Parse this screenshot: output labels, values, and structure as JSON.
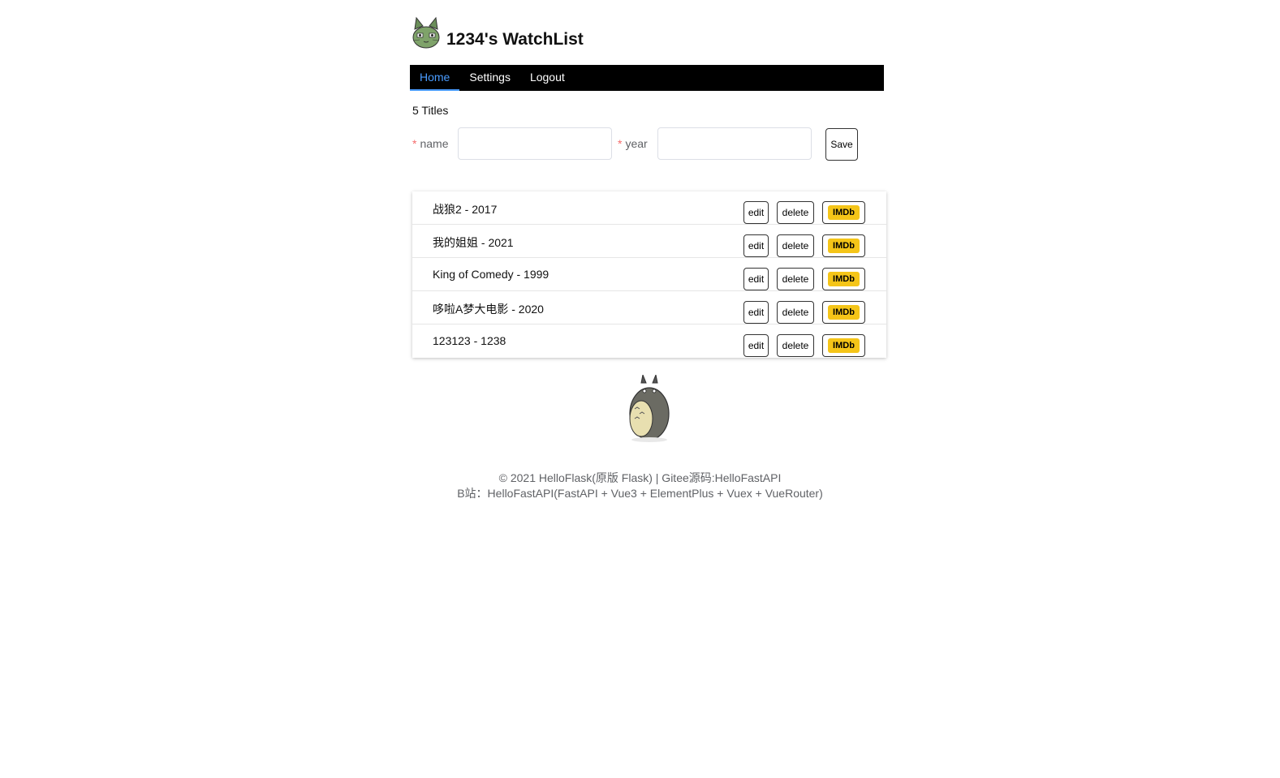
{
  "header": {
    "title": "1234's WatchList",
    "avatar_icon": "cat-avatar-icon"
  },
  "nav": {
    "items": [
      {
        "label": "Home",
        "active": true
      },
      {
        "label": "Settings",
        "active": false
      },
      {
        "label": "Logout",
        "active": false
      }
    ]
  },
  "summary": {
    "count_text": "5 Titles"
  },
  "form": {
    "name_label": "name",
    "name_required": "*",
    "name_value": "",
    "year_label": "year",
    "year_required": "*",
    "year_value": "",
    "save_label": "Save"
  },
  "movies": [
    {
      "title": "战狼2 - 2017",
      "edit": "edit",
      "delete": "delete",
      "imdb": "IMDb"
    },
    {
      "title": "我的姐姐 - 2021",
      "edit": "edit",
      "delete": "delete",
      "imdb": "IMDb"
    },
    {
      "title": "King of Comedy - 1999",
      "edit": "edit",
      "delete": "delete",
      "imdb": "IMDb"
    },
    {
      "title": "哆啦A梦大电影 - 2020",
      "edit": "edit",
      "delete": "delete",
      "imdb": "IMDb"
    },
    {
      "title": "123123 - 1238",
      "edit": "edit",
      "delete": "delete",
      "imdb": "IMDb"
    }
  ],
  "footer": {
    "line1": "© 2021 HelloFlask(原版 Flask) | Gitee源码:HelloFastAPI",
    "line2": "B站：HelloFastAPI(FastAPI + Vue3 + ElementPlus + Vuex + VueRouter)"
  },
  "colors": {
    "accent": "#4a9cff",
    "navbar": "#000000",
    "imdb": "#f5c518",
    "required": "#f56c6c"
  }
}
